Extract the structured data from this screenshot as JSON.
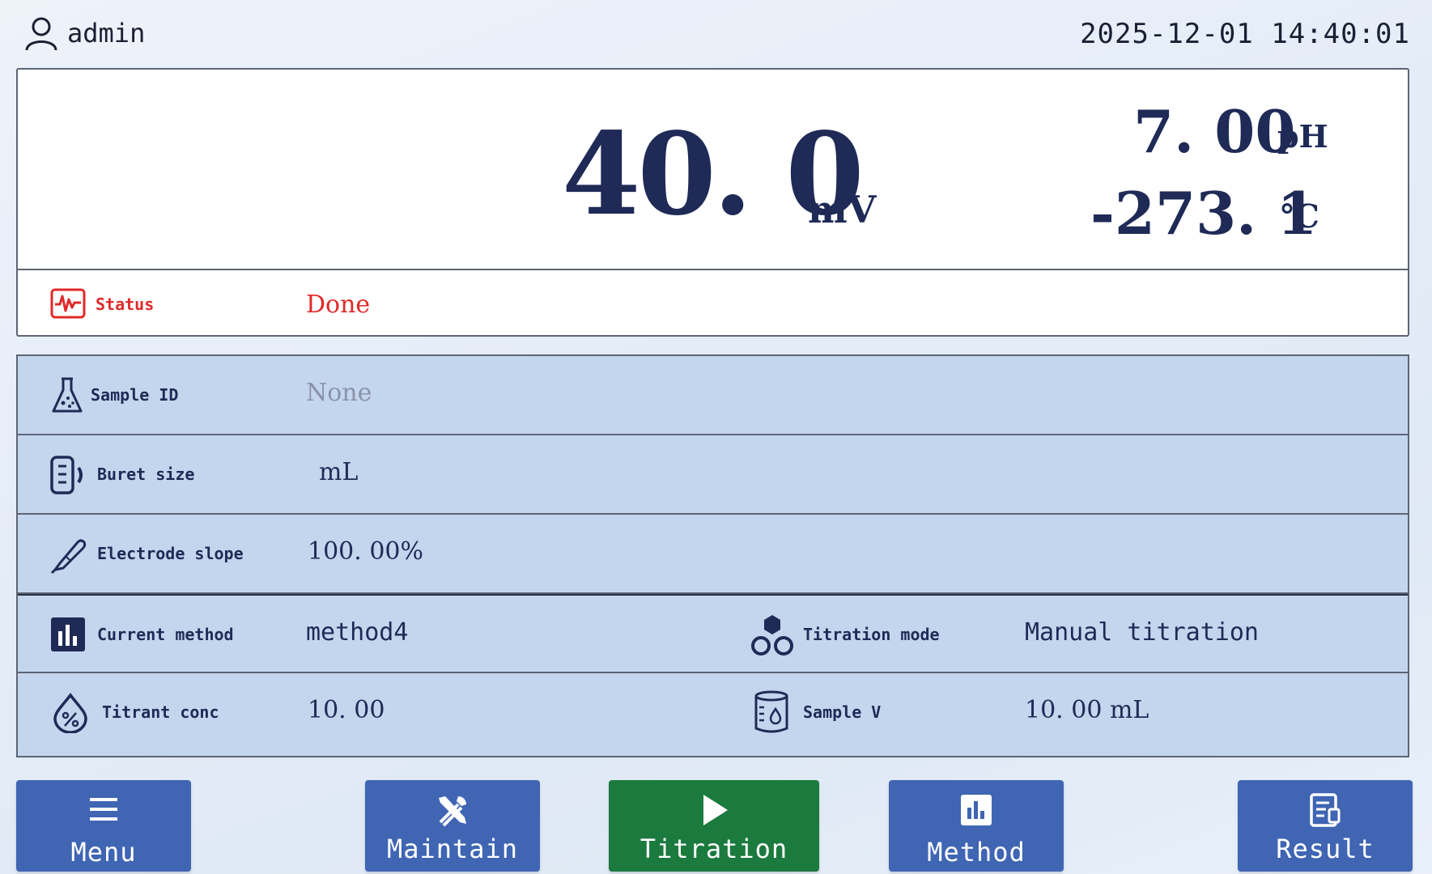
{
  "header": {
    "user_icon": "user-icon",
    "username": "admin",
    "datetime": "2025-12-01 14:40:01"
  },
  "reading": {
    "main_value": "40. 0",
    "main_unit": "mV",
    "ph_value": "7. 00",
    "ph_unit": "pH",
    "temp_value": "-273. 1",
    "temp_unit": "℃"
  },
  "status": {
    "icon": "waveform-icon",
    "label": "Status",
    "value": "Done",
    "color": "#e02a2a"
  },
  "info": {
    "sample_id": {
      "icon": "flask-icon",
      "label": "Sample ID",
      "value": "None"
    },
    "buret_size": {
      "icon": "buret-icon",
      "label": "Buret size",
      "value": "mL"
    },
    "electrode_slope": {
      "icon": "electrode-icon",
      "label": "Electrode slope",
      "value": "100. 00%"
    },
    "current_method": {
      "icon": "chart-icon",
      "label": "Current method",
      "value": "method4"
    },
    "titration_mode": {
      "icon": "molecule-icon",
      "label": "Titration mode",
      "value": "Manual titration"
    },
    "titrant_conc": {
      "icon": "percent-drop-icon",
      "label": "Titrant conc",
      "value": "10. 00"
    },
    "sample_v": {
      "icon": "container-icon",
      "label": "Sample V",
      "value": "10. 00 mL"
    }
  },
  "buttons": {
    "menu": {
      "label": "Menu",
      "icon": "hamburger-icon"
    },
    "maintain": {
      "label": "Maintain",
      "icon": "tools-icon"
    },
    "titration": {
      "label": "Titration",
      "icon": "play-icon"
    },
    "method": {
      "label": "Method",
      "icon": "chart-icon"
    },
    "result": {
      "label": "Result",
      "icon": "document-icon"
    }
  },
  "colors": {
    "accent_blue": "#3f65b3",
    "accent_green": "#1b7a3e",
    "panel_blue": "#c4d6ee",
    "text_dark": "#1f2a56"
  }
}
